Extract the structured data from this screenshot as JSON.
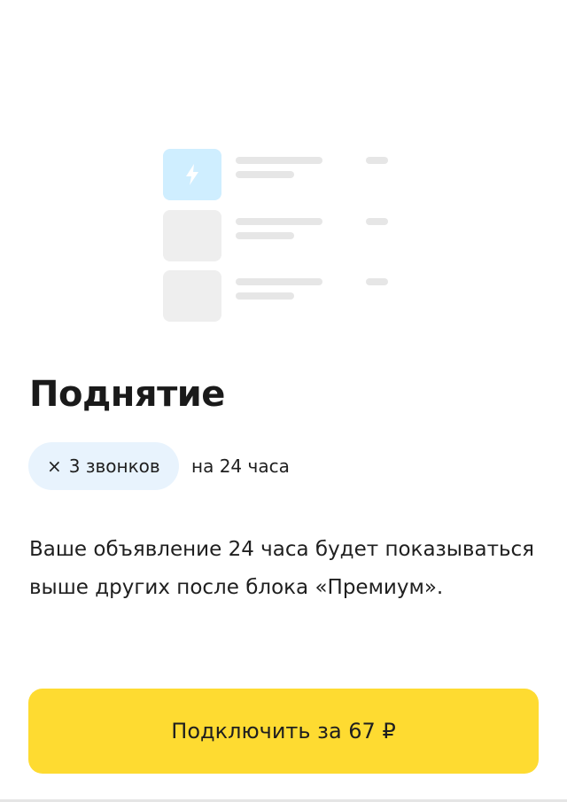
{
  "illustration": {
    "rows": [
      {
        "state": "active",
        "icon": "lightning-icon"
      },
      {
        "state": "inactive"
      },
      {
        "state": "inactive"
      }
    ],
    "colors": {
      "active_thumb": "#cfeeff",
      "thumb": "#eeeeee",
      "line": "#e6e6e6",
      "icon": "#ffffff"
    }
  },
  "title": "Поднятие",
  "tags": {
    "multiplier_symbol": "×",
    "calls": "3 звонков",
    "duration": "на 24 часа"
  },
  "description": "Ваше объявление 24 часа будет показываться выше других после блока «Премиум».",
  "cta": {
    "label": "Подключить за 67 ₽"
  },
  "colors": {
    "accent": "#fedb31",
    "pill_background": "#e8f3fd",
    "text": "#1f1f1f"
  }
}
